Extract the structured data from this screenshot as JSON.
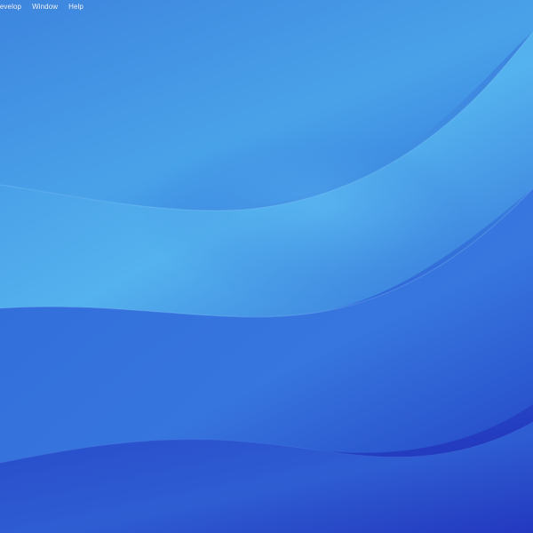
{
  "menubar": {
    "items": [
      {
        "label": "Develop"
      },
      {
        "label": "Window"
      },
      {
        "label": "Help"
      }
    ]
  },
  "colors": {
    "wallpaper_top": "#3b78dd",
    "wallpaper_highlight": "#56b0ee",
    "wallpaper_bottom": "#2338bf",
    "menu_text": "#ffffff"
  }
}
